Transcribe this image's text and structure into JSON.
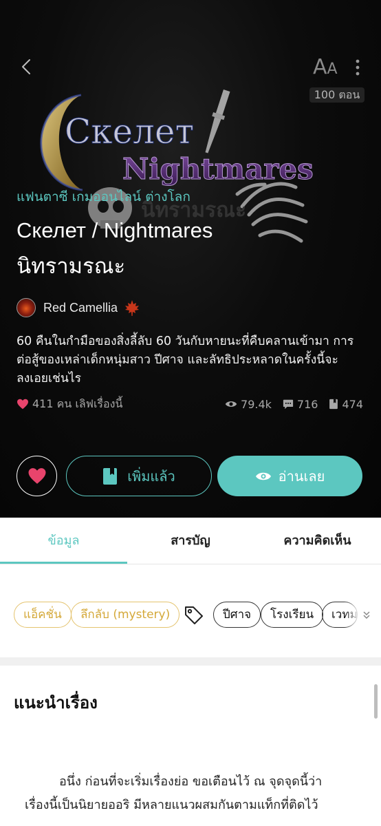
{
  "header": {
    "more_icon": "more-vertical-icon",
    "back_icon": "chevron-left-icon",
    "font_size_label_big": "A",
    "font_size_label_small": "A",
    "episode_count": "100 ตอน"
  },
  "cover": {
    "logo_line1": "Cкелет",
    "logo_line2": "Nightmares",
    "logo_thai": "นิทรามรณะ"
  },
  "novel": {
    "genres": "แฟนตาซี เกมออนไลน์ ต่างโลก",
    "title_line1": "Cкелет / Nightmares",
    "title_line2": "นิทรามรณะ",
    "author": "Red Camellia",
    "synopsis": "60 คืนในกำมือของสิ่งลี้ลับ 60 วันกับหายนะที่คืบคลานเข้ามา การต่อสู้ของเหล่าเด็กหนุ่มสาว ปีศาจ และลัทธิประหลาดในครั้งนี้จะลงเอยเช่นไร"
  },
  "stats": {
    "likes": "411 คน เลิฟเรื่องนี้",
    "views": "79.4k",
    "comments": "716",
    "bookmarks": "474"
  },
  "actions": {
    "added_label": "เพิ่มแล้ว",
    "read_label": "อ่านเลย"
  },
  "tabs": [
    {
      "label": "ข้อมูล"
    },
    {
      "label": "สารบัญ"
    },
    {
      "label": "ความคิดเห็น"
    }
  ],
  "tags": {
    "categories": [
      "แอ็คชั่น",
      "ลึกลับ (mystery)"
    ],
    "keywords": [
      "ปีศาจ",
      "โรงเรียน",
      "เวทม"
    ]
  },
  "intro": {
    "heading": "แนะนำเรื่อง",
    "line1": "อนึ่ง ก่อนที่จะเริ่มเรื่องย่อ ขอเตือนไว้ ณ จุดจุดนี้ว่า",
    "line2": "เรื่องนี้เป็นนิยายออริ มีหลายแนวผสมกันตามแท็กที่ติดไว้"
  },
  "colors": {
    "accent": "#5cc7c0",
    "heart": "#e8446c",
    "tag_gold": "#d4a838",
    "hero_bg": "#0a0a0a"
  }
}
